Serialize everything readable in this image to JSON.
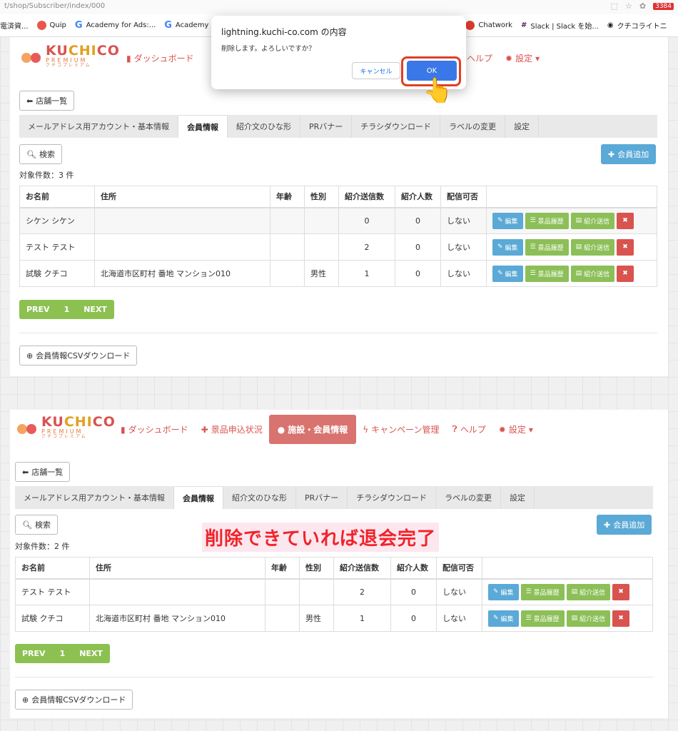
{
  "browser": {
    "url": "t/shop/Subscriber/index/000",
    "notif_count": "3384",
    "bookmarks": [
      {
        "label": "電済資...",
        "icon": "folder-icon",
        "color": "#777"
      },
      {
        "label": "Quip",
        "icon": "quip-icon",
        "color": "#e8574a"
      },
      {
        "label": "Academy for Ads:...",
        "icon": "google-icon",
        "color": "#4285f4"
      },
      {
        "label": "Academy",
        "icon": "google-icon",
        "color": "#4285f4"
      },
      {
        "label": "Chatwork",
        "icon": "chatwork-icon",
        "color": "#e23b2e"
      },
      {
        "label": "Slack | Slack を始...",
        "icon": "slack-icon",
        "color": "#611f69"
      },
      {
        "label": "クチコライトニ",
        "icon": "globe-icon",
        "color": "#333"
      }
    ]
  },
  "dialog": {
    "title": "lightning.kuchi-co.com の内容",
    "message": "削除します。よろしいですか？",
    "cancel": "キャンセル",
    "ok": "OK"
  },
  "logo": {
    "main_a": "KU",
    "main_b": "CHI",
    "main_c": "CO",
    "sub": "PREMIUM",
    "kana": "クチコプレミアム"
  },
  "nav": {
    "dashboard": "ダッシュボード",
    "prizes": "景品申込状況",
    "members": "施設・会員情報",
    "campaign": "キャンペーン管理",
    "help": "ヘルプ",
    "settings": "設定"
  },
  "shop_list": "店舗一覧",
  "tabs": [
    "メールアドレス用アカウント・基本情報",
    "会員情報",
    "紹介文のひな形",
    "PRバナー",
    "チラシダウンロード",
    "ラベルの変更",
    "設定"
  ],
  "search": "検索",
  "add_member": "会員追加",
  "headers": [
    "お名前",
    "住所",
    "年齢",
    "性別",
    "紹介送信数",
    "紹介人数",
    "配信可否"
  ],
  "actions": {
    "edit": "編集",
    "history": "景品履歴",
    "send": "紹介送信"
  },
  "before": {
    "count": "対象件数：3 件",
    "rows": [
      {
        "name": "シケン シケン",
        "address": "",
        "age": "",
        "gender": "",
        "sent": "0",
        "referred": "0",
        "deliver": "しない"
      },
      {
        "name": "テスト テスト",
        "address": "",
        "age": "",
        "gender": "",
        "sent": "2",
        "referred": "0",
        "deliver": "しない"
      },
      {
        "name": "試験 クチコ",
        "address": "北海道市区町村 番地 マンション010",
        "age": "",
        "gender": "男性",
        "sent": "1",
        "referred": "0",
        "deliver": "しない"
      }
    ]
  },
  "after": {
    "count": "対象件数：2 件",
    "rows": [
      {
        "name": "テスト テスト",
        "address": "",
        "age": "",
        "gender": "",
        "sent": "2",
        "referred": "0",
        "deliver": "しない"
      },
      {
        "name": "試験 クチコ",
        "address": "北海道市区町村 番地 マンション010",
        "age": "",
        "gender": "男性",
        "sent": "1",
        "referred": "0",
        "deliver": "しない"
      }
    ]
  },
  "pager": {
    "prev": "PREV",
    "page": "1",
    "next": "NEXT"
  },
  "csv": "会員情報CSVダウンロード",
  "annotation": "削除できていれば退会完了",
  "colors": {
    "brand": "#d9534f",
    "accent_blue": "#5aa9d6",
    "green": "#8cc152",
    "annotation": "#f0242a"
  }
}
